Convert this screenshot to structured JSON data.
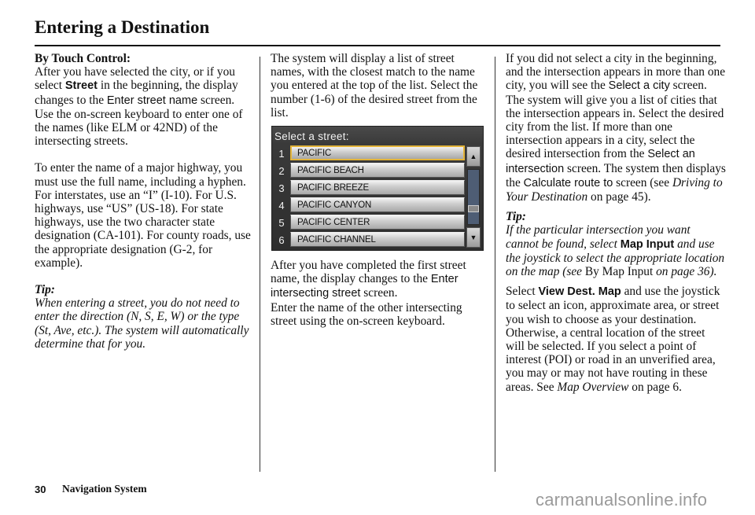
{
  "header": {
    "title": "Entering a Destination"
  },
  "column1": {
    "heading": "By Touch Control:",
    "para1": {
      "t1": "After you have selected the city, or if you select ",
      "b1": "Street",
      "t2": " in the beginning, the display changes to the ",
      "ui1": "Enter street name",
      "t3": " screen. Use the on-screen keyboard to enter one of the names (like ELM or 42ND) of the intersecting streets."
    },
    "para2": "To enter the name of a major highway, you must use the full name, including a hyphen. For interstates, use an “I” (I-10). For U.S. highways, use “US” (US-18). For state highways, use the two character state designation (CA-101). For county roads, use the appropriate designation (G-2, for example).",
    "tip_label": "Tip:",
    "tip_text": "When entering a street, you do not need to enter the direction (N, S, E, W) or the type (St, Ave, etc.). The system will automatically determine that for you."
  },
  "column2": {
    "para1": "The system will display a list of street names, with the closest match to the name you entered at the top of the list. Select the number (1-6) of the desired street from the list.",
    "screen": {
      "title": "Select a street:",
      "items": [
        {
          "num": "1",
          "label": "PACIFIC",
          "selected": true
        },
        {
          "num": "2",
          "label": "PACIFIC BEACH"
        },
        {
          "num": "3",
          "label": "PACIFIC BREEZE"
        },
        {
          "num": "4",
          "label": "PACIFIC CANYON"
        },
        {
          "num": "5",
          "label": "PACIFIC CENTER"
        },
        {
          "num": "6",
          "label": "PACIFIC CHANNEL"
        }
      ],
      "scroll_up": "▲",
      "scroll_down": "▼",
      "scroll_position": 0.75
    },
    "para2": {
      "t1": "After you have completed the first street name, the display changes to the ",
      "ui1": "Enter intersecting street",
      "t2": " screen."
    },
    "para3": "Enter the name of the other intersecting street using the on-screen keyboard."
  },
  "column3": {
    "para1": {
      "t1": "If you did not select a city in the beginning, and the intersection appears in more than one city, you will see the ",
      "ui1": "Select a city",
      "t2": " screen. The system will give you a list of cities that the intersection appears in. Select the desired city from the list. If more than one intersection appears in a city, select the desired intersection from the ",
      "ui2": "Select an intersection",
      "t3": " screen. The system then displays the ",
      "ui3": "Calculate route to",
      "t4": " screen (see ",
      "it1": "Driving to Your Destination",
      "t5": " on page 45)."
    },
    "tip_label": "Tip:",
    "tip": {
      "t1": "If the particular intersection you want cannot be found, select ",
      "b1": "Map Input",
      "t2": " and use the joystick to select the appropriate location on the map (see ",
      "r1": "By Map Input",
      "t3": " on page 36)."
    },
    "para2": {
      "t1": "Select ",
      "b1": "View Dest. Map",
      "t2": " and use the joystick to select an icon, approximate area, or street you wish to choose as your destination. Otherwise, a central location of the street will be selected. If you select a point of interest (POI) or road in an unverified area, you may or may not have routing in these areas. See ",
      "it1": "Map Overview",
      "t3": " on page 6."
    }
  },
  "footer": {
    "page_number": "30",
    "section": "Navigation System",
    "watermark": "carmanualsonline.info"
  }
}
